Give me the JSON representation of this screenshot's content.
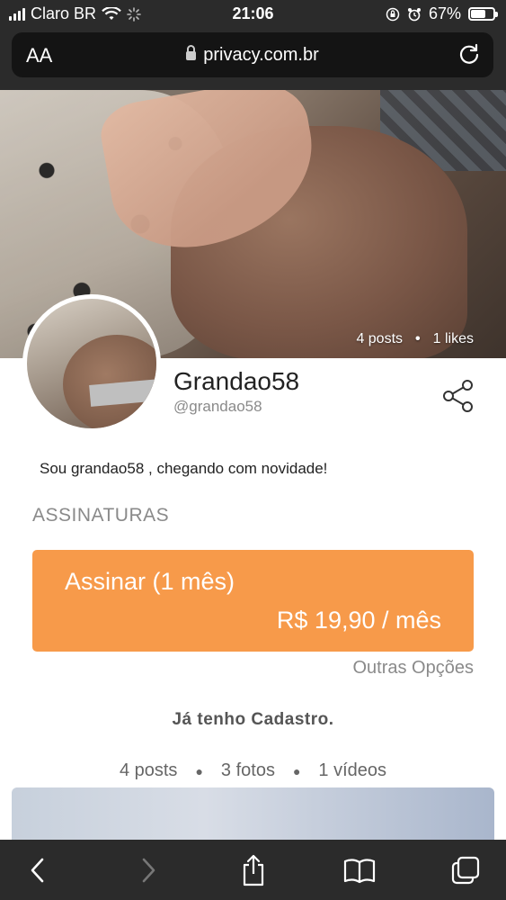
{
  "status_bar": {
    "carrier": "Claro BR",
    "time": "21:06",
    "battery_percent": "67%",
    "battery_level": 0.67
  },
  "browser": {
    "aa_label": "AA",
    "url": "privacy.com.br"
  },
  "cover": {
    "posts": "4 posts",
    "likes": "1 likes"
  },
  "profile": {
    "name": "Grandao58",
    "handle": "@grandao58",
    "bio": "Sou grandao58 , chegando com novidade!"
  },
  "subscriptions": {
    "title": "ASSINATURAS",
    "plan_label": "Assinar (1 mês)",
    "plan_price": "R$ 19,90 / mês",
    "other_options": "Outras Opções",
    "accent_color": "#f79a4a"
  },
  "login_link": "Já tenho Cadastro.",
  "content_stats": {
    "posts": "4 posts",
    "photos": "3 fotos",
    "videos": "1 vídeos"
  },
  "icons": {
    "lock": "lock-icon",
    "reload": "reload-icon",
    "share": "share-icon",
    "back": "chevron-left-icon",
    "forward": "chevron-right-icon",
    "share_sheet": "share-upload-icon",
    "bookmarks": "book-icon",
    "tabs": "tabs-icon"
  }
}
